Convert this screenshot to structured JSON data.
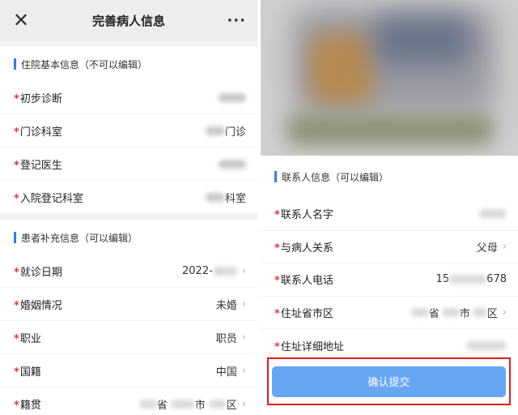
{
  "left": {
    "header": {
      "close_icon": "close-icon",
      "title": "完善病人信息",
      "more_label": "···"
    },
    "section1": {
      "title": "住院基本信息（不可以编辑）",
      "rows": [
        {
          "label": "初步诊断",
          "value": "",
          "arrow": false
        },
        {
          "label": "门诊科室",
          "value": "门诊",
          "arrow": false
        },
        {
          "label": "登记医生",
          "value": "",
          "arrow": false
        },
        {
          "label": "入院登记科室",
          "value": "科室",
          "arrow": false
        }
      ]
    },
    "section2": {
      "title": "患者补充信息（可以编辑）",
      "rows": [
        {
          "label": "就诊日期",
          "value": "2022-",
          "arrow": true
        },
        {
          "label": "婚姻情况",
          "value": "未婚",
          "arrow": true
        },
        {
          "label": "职业",
          "value": "职员",
          "arrow": true
        },
        {
          "label": "国籍",
          "value": "中国",
          "arrow": true
        },
        {
          "label": "籍贯",
          "value_parts": [
            "省",
            "市",
            "区"
          ],
          "arrow": true
        }
      ]
    }
  },
  "right": {
    "section": {
      "title": "联系人信息（可以编辑）",
      "rows": [
        {
          "label": "联系人名字",
          "value": ""
        },
        {
          "label": "与病人关系",
          "value": "父母",
          "arrow": true
        },
        {
          "label": "联系人电话",
          "value_prefix": "15",
          "value_suffix": "678"
        },
        {
          "label": "住址省市区",
          "value_parts": [
            "省",
            "市",
            "区"
          ],
          "arrow": true
        },
        {
          "label": "住址详细地址",
          "value": ""
        }
      ]
    },
    "submit_label": "确认提交"
  },
  "required_mark": "*",
  "chevron": "›",
  "colors": {
    "accent_bar": "#2f7cf6",
    "required": "#e33333",
    "button": "#67a6f3",
    "highlight_border": "#e11c1c"
  }
}
